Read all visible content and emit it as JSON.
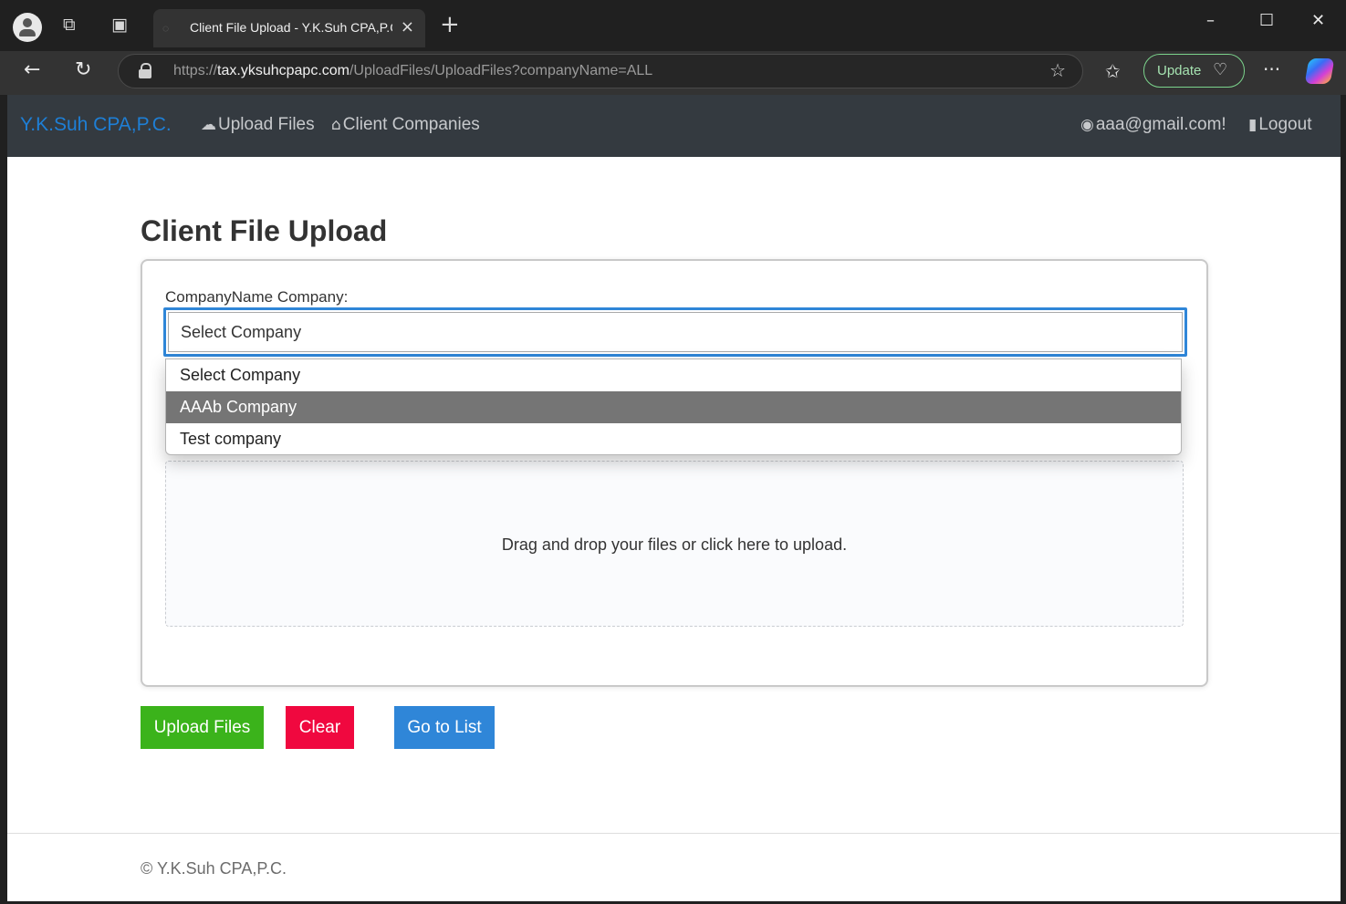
{
  "browser": {
    "tab_title": "Client File Upload - Y.K.Suh CPA,P.C.",
    "url_scheme": "https://",
    "url_host": "tax.yksuhcpapc.com",
    "url_path": "/UploadFiles/UploadFiles?companyName=ALL",
    "update_label": "Update",
    "icons": {
      "profile": "profile-icon",
      "workspaces": "workspaces-icon",
      "vertical_tabs": "vertical-tabs-icon",
      "close_tab": "close-icon",
      "new_tab": "plus-icon",
      "back": "back-arrow-icon",
      "refresh": "refresh-icon",
      "lock": "lock-icon",
      "favorite": "star-icon",
      "favorites": "favorites-icon",
      "menu": "more-icon",
      "copilot": "copilot-icon"
    }
  },
  "site": {
    "brand": "Y.K.Suh CPA,P.C.",
    "nav": {
      "upload_files": "Upload Files",
      "client_companies": "Client Companies",
      "user": "aaa@gmail.com!",
      "logout": "Logout"
    },
    "brand_color": "#1e7fd6"
  },
  "main": {
    "title": "Client File Upload",
    "company_label": "CompanyName Company:",
    "select_value": "Select Company",
    "options": [
      {
        "label": "Select Company",
        "selected": false
      },
      {
        "label": "AAAb Company",
        "selected": true
      },
      {
        "label": "Test company",
        "selected": false
      }
    ],
    "dropzone_text": "Drag and drop your files or click here to upload.",
    "buttons": {
      "upload": "Upload Files",
      "clear": "Clear",
      "list": "Go to List"
    },
    "colors": {
      "upload": "#3bb31b",
      "clear": "#f0083f",
      "list": "#2f86d8"
    }
  },
  "footer": {
    "text": "© Y.K.Suh CPA,P.C."
  }
}
